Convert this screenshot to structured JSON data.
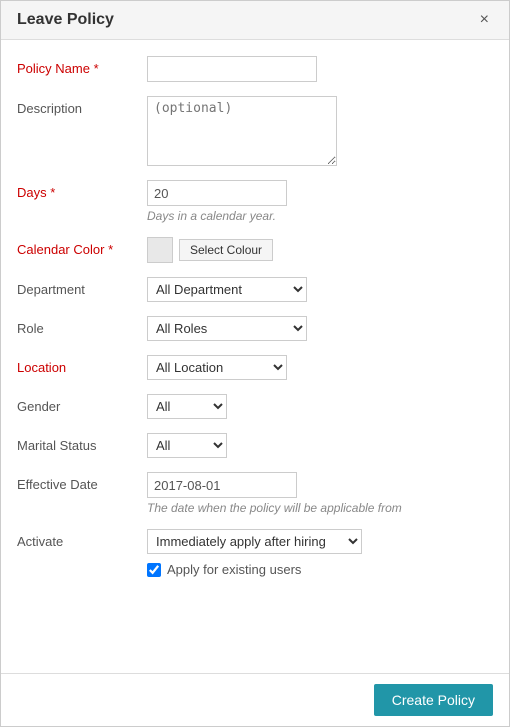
{
  "dialog": {
    "title": "Leave Policy",
    "close_label": "×"
  },
  "form": {
    "policy_name_label": "Policy Name",
    "policy_name_required": true,
    "policy_name_value": "",
    "description_label": "Description",
    "description_placeholder": "(optional)",
    "days_label": "Days",
    "days_required": true,
    "days_value": "20",
    "days_hint": "Days in a calendar year.",
    "calendar_color_label": "Calendar Color",
    "calendar_color_required": true,
    "select_colour_label": "Select Colour",
    "department_label": "Department",
    "department_options": [
      "All Department"
    ],
    "department_selected": "All Department",
    "role_label": "Role",
    "role_options": [
      "All Roles"
    ],
    "role_selected": "All Roles",
    "location_label": "Location",
    "location_options": [
      "All Location"
    ],
    "location_selected": "All Location",
    "gender_label": "Gender",
    "gender_options": [
      "All"
    ],
    "gender_selected": "All",
    "marital_status_label": "Marital Status",
    "marital_options": [
      "All"
    ],
    "marital_selected": "All",
    "effective_date_label": "Effective Date",
    "effective_date_value": "2017-08-01",
    "effective_date_hint": "The date when the policy will be applicable from",
    "activate_label": "Activate",
    "activate_options": [
      "Immediately apply after hiring"
    ],
    "activate_selected": "Immediately apply after hiring",
    "apply_existing_label": "Apply for existing users",
    "apply_existing_checked": true
  },
  "footer": {
    "create_policy_label": "Create Policy"
  }
}
